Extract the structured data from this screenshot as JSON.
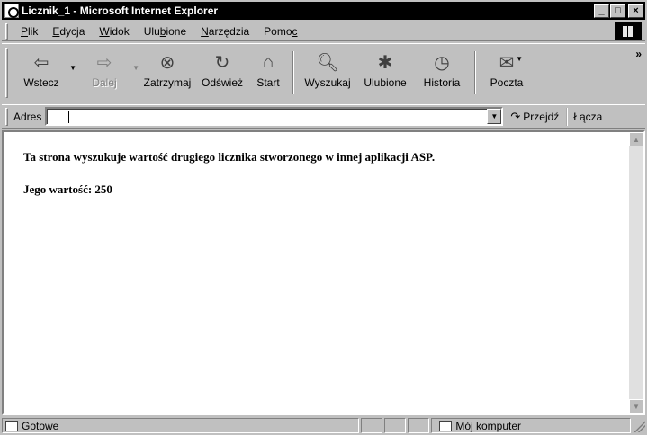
{
  "window": {
    "title": "Licznik_1 - Microsoft Internet Explorer",
    "minimize": "_",
    "maximize": "□",
    "close": "×"
  },
  "menu": {
    "items": [
      {
        "pre": "",
        "u": "P",
        "post": "lik"
      },
      {
        "pre": "",
        "u": "E",
        "post": "dycja"
      },
      {
        "pre": "",
        "u": "W",
        "post": "idok"
      },
      {
        "pre": "Ulu",
        "u": "b",
        "post": "ione"
      },
      {
        "pre": "",
        "u": "N",
        "post": "arzędzia"
      },
      {
        "pre": "Pomo",
        "u": "c",
        "post": ""
      }
    ]
  },
  "toolbar": {
    "back": "Wstecz",
    "forward": "Dalej",
    "stop": "Zatrzymaj",
    "refresh": "Odśwież",
    "home": "Start",
    "search": "Wyszukaj",
    "favorites": "Ulubione",
    "history": "Historia",
    "mail": "Poczta",
    "more": "»"
  },
  "address": {
    "label": "Adres",
    "value": "",
    "go": "Przejdź",
    "links": "Łącza"
  },
  "content": {
    "line1": "Ta strona wyszukuje wartość drugiego licznika stworzonego w innej aplikacji ASP.",
    "line2": "Jego wartość: 250"
  },
  "status": {
    "text": "Gotowe",
    "zone": "Mój komputer"
  }
}
